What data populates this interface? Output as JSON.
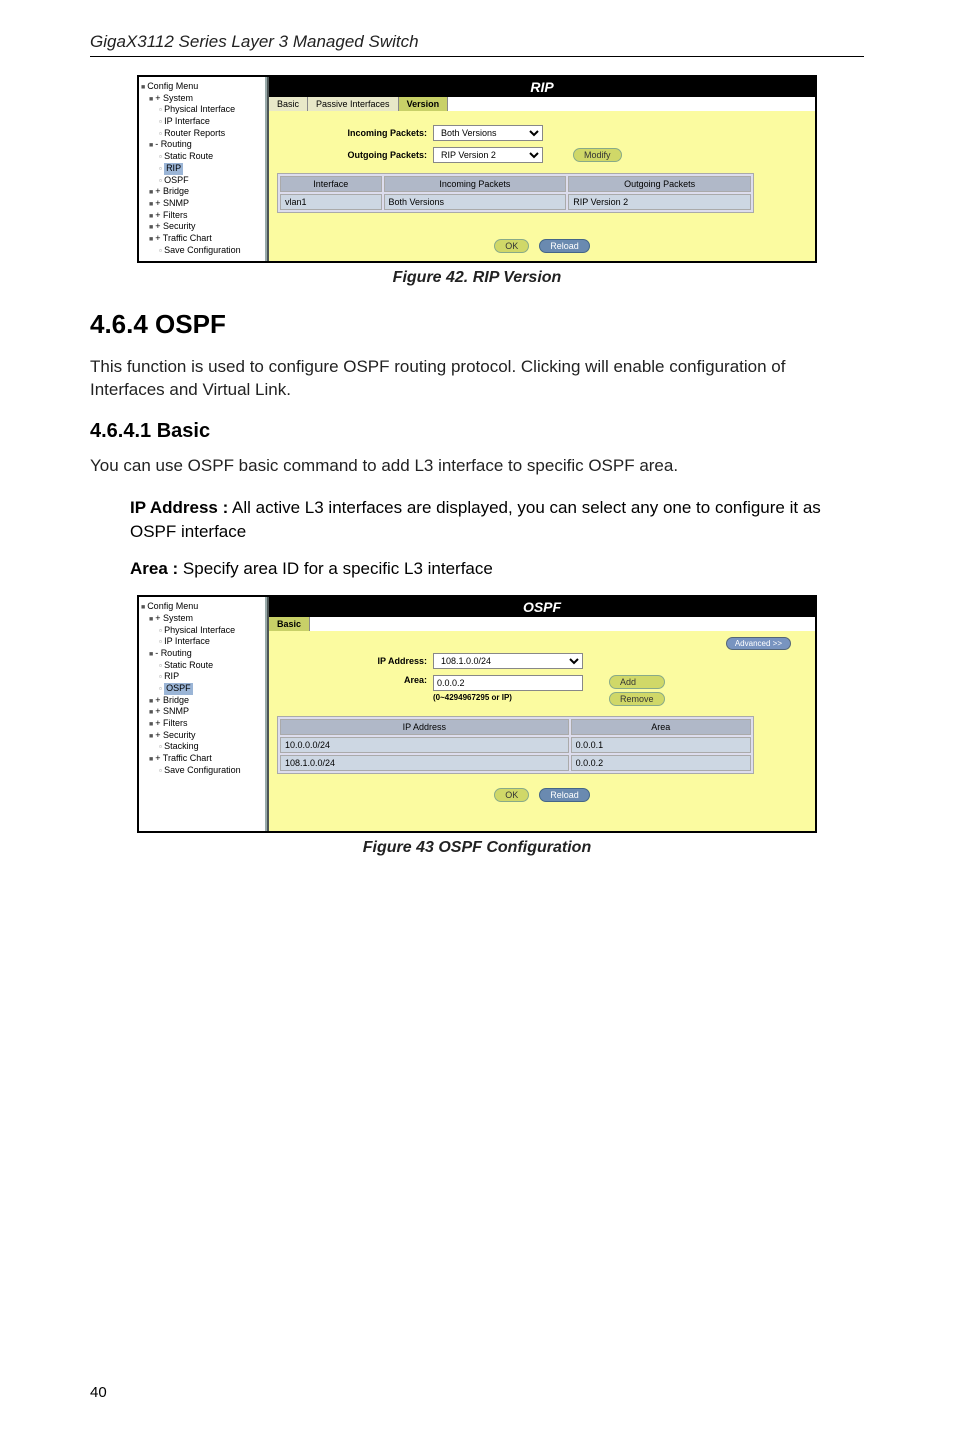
{
  "header": {
    "product": "GigaX3112 Series Layer 3 Managed Switch"
  },
  "fig42": {
    "caption": "Figure 42. RIP Version",
    "title": "RIP",
    "tabs": [
      "Basic",
      "Passive Interfaces",
      "Version"
    ],
    "activeTab": 2,
    "tree": {
      "root": "Config Menu",
      "items": [
        {
          "t": "System",
          "lvl": 1,
          "exp": "+",
          "box": 1
        },
        {
          "t": "Physical Interface",
          "lvl": 2,
          "file": 1
        },
        {
          "t": "IP Interface",
          "lvl": 2,
          "file": 1
        },
        {
          "t": "Router Reports",
          "lvl": 2,
          "file": 1
        },
        {
          "t": "Routing",
          "lvl": 1,
          "exp": "-",
          "box": 1
        },
        {
          "t": "Static Route",
          "lvl": 2,
          "file": 1
        },
        {
          "t": "RIP",
          "lvl": 2,
          "file": 1,
          "sel": 1
        },
        {
          "t": "OSPF",
          "lvl": 2,
          "file": 1
        },
        {
          "t": "Bridge",
          "lvl": 1,
          "exp": "+",
          "box": 1
        },
        {
          "t": "SNMP",
          "lvl": 1,
          "exp": "+",
          "box": 1
        },
        {
          "t": "Filters",
          "lvl": 1,
          "exp": "+",
          "box": 1
        },
        {
          "t": "Security",
          "lvl": 1,
          "exp": "+",
          "box": 1
        },
        {
          "t": "Traffic Chart",
          "lvl": 1,
          "exp": "+",
          "box": 1
        },
        {
          "t": "Save Configuration",
          "lvl": 2,
          "file": 1
        }
      ]
    },
    "form": {
      "incomingLabel": "Incoming Packets:",
      "incomingValue": "Both Versions",
      "outgoingLabel": "Outgoing Packets:",
      "outgoingValue": "RIP Version 2",
      "modify": "Modify"
    },
    "table": {
      "headers": [
        "Interface",
        "Incoming Packets",
        "Outgoing Packets"
      ],
      "rows": [
        [
          "vlan1",
          "Both Versions",
          "RIP Version 2"
        ]
      ]
    },
    "buttons": {
      "ok": "OK",
      "reload": "Reload"
    }
  },
  "section": {
    "h2": "4.6.4   OSPF",
    "p1": "This function is used to configure OSPF routing protocol. Clicking    will enable configuration of Interfaces and Virtual Link.",
    "h3": "4.6.4.1   Basic",
    "p2": "You can use OSPF basic command to add L3 interface to specific OSPF area.",
    "ipLabel": "IP Address :",
    "ipText": " All active L3 interfaces are displayed, you can select any one to configure it as OSPF interface",
    "areaLabel": "Area :",
    "areaText": " Specify area ID for a specific L3 interface"
  },
  "fig43": {
    "caption": "Figure 43 OSPF Configuration",
    "title": "OSPF",
    "tabs": [
      "Basic"
    ],
    "activeTab": 0,
    "advanced": "Advanced >>",
    "tree": {
      "root": "Config Menu",
      "items": [
        {
          "t": "System",
          "lvl": 1,
          "exp": "+",
          "box": 1
        },
        {
          "t": "Physical Interface",
          "lvl": 2,
          "file": 1
        },
        {
          "t": "IP Interface",
          "lvl": 2,
          "file": 1
        },
        {
          "t": "Routing",
          "lvl": 1,
          "exp": "-",
          "box": 1
        },
        {
          "t": "Static Route",
          "lvl": 2,
          "file": 1
        },
        {
          "t": "RIP",
          "lvl": 2,
          "file": 1
        },
        {
          "t": "OSPF",
          "lvl": 2,
          "file": 1,
          "sel": 1
        },
        {
          "t": "Bridge",
          "lvl": 1,
          "exp": "+",
          "box": 1
        },
        {
          "t": "SNMP",
          "lvl": 1,
          "exp": "+",
          "box": 1
        },
        {
          "t": "Filters",
          "lvl": 1,
          "exp": "+",
          "box": 1
        },
        {
          "t": "Security",
          "lvl": 1,
          "exp": "+",
          "box": 1
        },
        {
          "t": "Stacking",
          "lvl": 2,
          "file": 1
        },
        {
          "t": "Traffic Chart",
          "lvl": 1,
          "exp": "+",
          "box": 1
        },
        {
          "t": "Save Configuration",
          "lvl": 2,
          "file": 1
        }
      ]
    },
    "form": {
      "ipLabel": "IP Address:",
      "ipValue": "108.1.0.0/24",
      "areaLabel": "Area:",
      "areaValue": "0.0.0.2",
      "hint": "(0~4294967295 or IP)",
      "add": "Add",
      "remove": "Remove"
    },
    "table": {
      "headers": [
        "IP Address",
        "Area"
      ],
      "rows": [
        [
          "10.0.0.0/24",
          "0.0.0.1"
        ],
        [
          "108.1.0.0/24",
          "0.0.0.2"
        ]
      ]
    },
    "buttons": {
      "ok": "OK",
      "reload": "Reload"
    }
  },
  "pagenum": "40"
}
